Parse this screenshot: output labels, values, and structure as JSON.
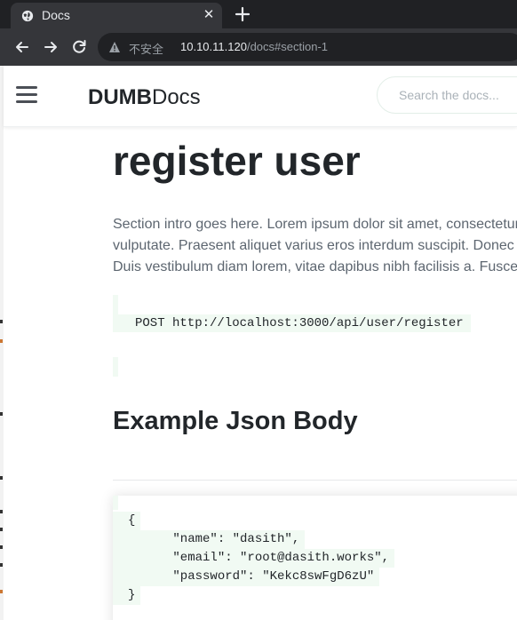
{
  "browser": {
    "tab_title": "Docs",
    "tab_close": "✕",
    "new_tab": "+",
    "not_secure": "不安全",
    "url_host": "10.10.11.120",
    "url_path": "/docs#section-1"
  },
  "header": {
    "brand_bold": "DUMB",
    "brand_rest": "Docs",
    "search_placeholder": "Search the docs..."
  },
  "section": {
    "title": "register user",
    "intro_lines": [
      "Section intro goes here. Lorem ipsum dolor sit amet, consectetur",
      "vulputate. Praesent aliquet varius eros interdum suscipit. Donec",
      "Duis vestibulum diam lorem, vitae dapibus nibh facilisis a. Fusce"
    ],
    "endpoint": "POST http://localhost:3000/api/user/register",
    "example_heading": "Example Json Body",
    "json_lines": [
      "{",
      "      \"name\": \"dasith\",",
      "      \"email\": \"root@dasith.works\",",
      "      \"password\": \"Kekc8swFgD6zU\"",
      "}"
    ]
  },
  "colors": {
    "chrome_dark": "#202124",
    "chrome_mid": "#35363a",
    "code_bg": "#f1faf3",
    "heading": "#22262a",
    "body_text": "#5d6670"
  },
  "icons": [
    "globe-icon",
    "close-icon",
    "plus-icon",
    "back-arrow-icon",
    "forward-arrow-icon",
    "reload-icon",
    "warning-icon",
    "hamburger-icon"
  ]
}
